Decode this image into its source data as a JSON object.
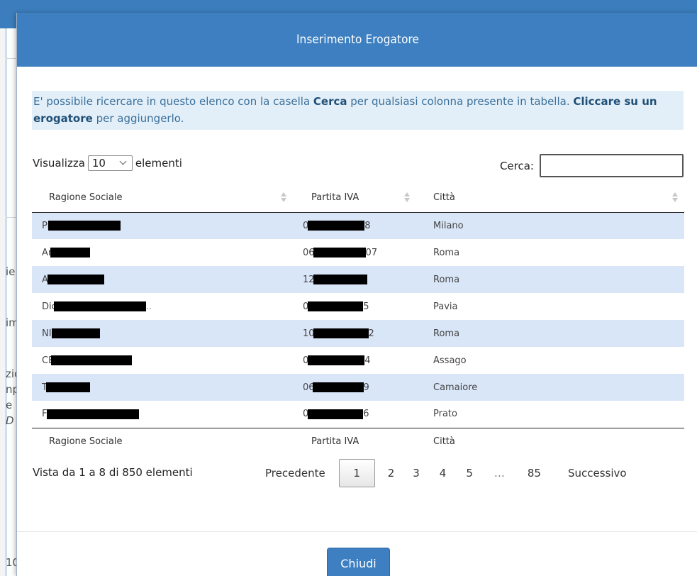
{
  "background": {
    "fragments": [
      "ie",
      "im",
      "zic",
      "np",
      "e (",
      "D",
      "10"
    ]
  },
  "modal": {
    "title": "Inserimento Erogatore",
    "info": {
      "text1": "E' possibile ricercare in questo elenco con la casella ",
      "bold1": "Cerca",
      "text2": " per qualsiasi colonna presente in tabella. ",
      "bold2": "Cliccare su un erogatore",
      "text3": " per aggiungerlo."
    },
    "length_label_pre": "Visualizza",
    "length_value": "10",
    "length_label_post": "elementi",
    "search_label": "Cerca:",
    "search_value": "",
    "columns": [
      "Ragione Sociale",
      "Partita IVA",
      "Città"
    ],
    "rows": [
      {
        "name_prefix": "Pr",
        "vat_prefix": "0",
        "vat_suffix": "8",
        "city": "Milano"
      },
      {
        "name_prefix": "Ar",
        "vat_prefix": "06",
        "vat_suffix": "07",
        "city": "Roma"
      },
      {
        "name_prefix": "A",
        "vat_prefix": "12",
        "vat_suffix": "",
        "city": "Roma"
      },
      {
        "name_prefix": "Dic",
        "vat_prefix": "0",
        "vat_suffix": "5",
        "city": "Pavia"
      },
      {
        "name_prefix": "NII",
        "vat_prefix": "10",
        "vat_suffix": "2",
        "city": "Roma"
      },
      {
        "name_prefix": "CE",
        "vat_prefix": "0",
        "vat_suffix": "4",
        "city": "Assago"
      },
      {
        "name_prefix": "T",
        "vat_prefix": "06",
        "vat_suffix": "9",
        "city": "Camaiore"
      },
      {
        "name_prefix": "Fi",
        "vat_prefix": "0",
        "vat_suffix": "6",
        "city": "Prato"
      }
    ],
    "table_info": "Vista da 1 a 8 di 850 elementi",
    "pagination": {
      "previous": "Precedente",
      "pages": [
        "1",
        "2",
        "3",
        "4",
        "5",
        "…",
        "85"
      ],
      "next": "Successivo"
    },
    "close_button": "Chiudi"
  }
}
